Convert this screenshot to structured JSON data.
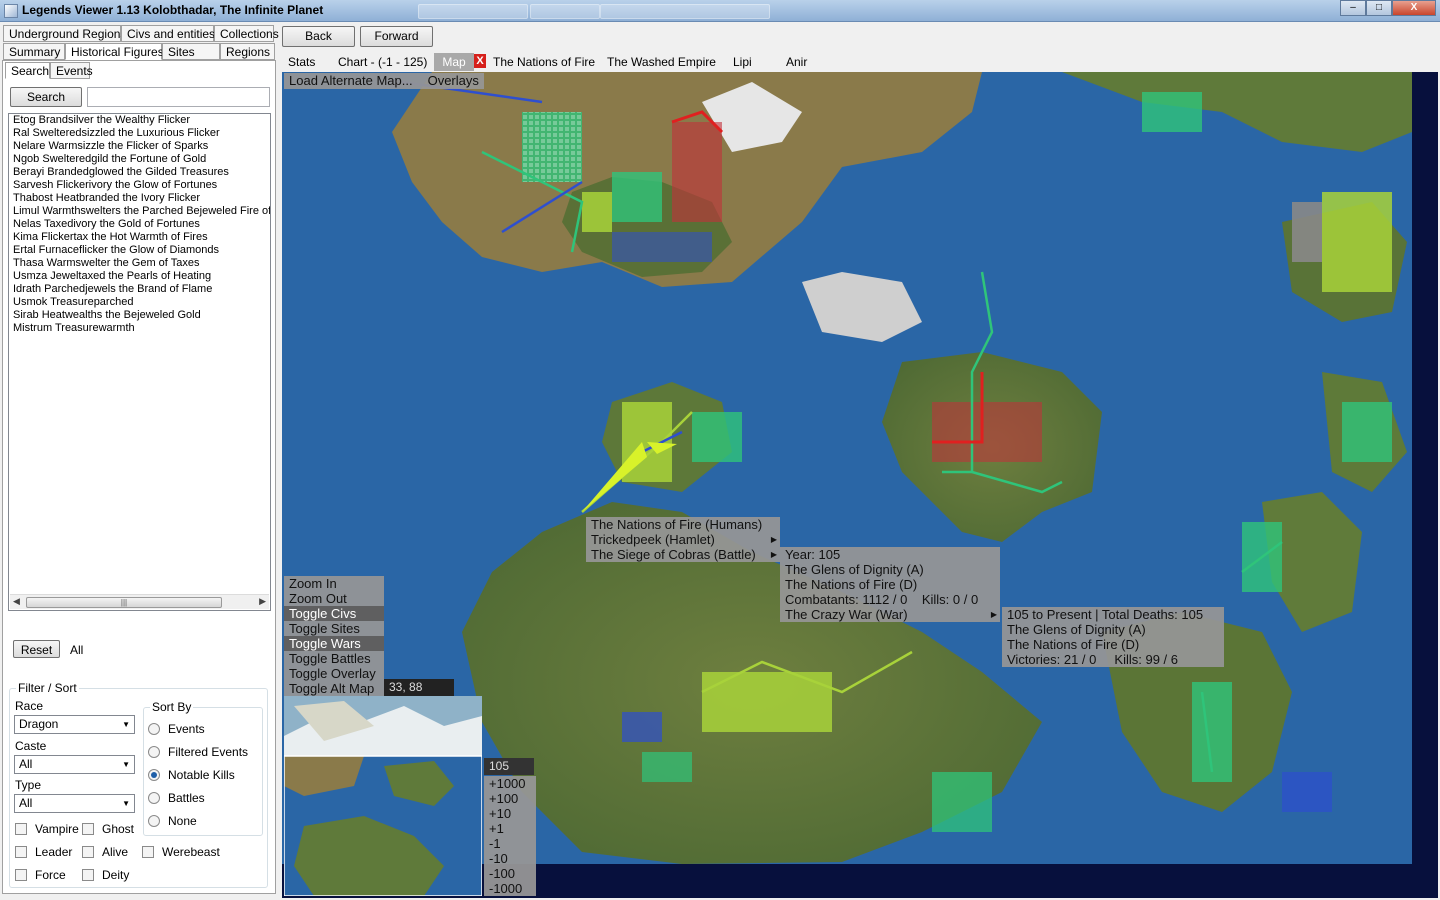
{
  "window": {
    "title": "Legends Viewer 1.13 Kolobthadar, The Infinite Planet",
    "minimize": "–",
    "maximize": "□",
    "close": "X"
  },
  "tabs_row1": [
    "Underground Regions",
    "Civs and entities",
    "Collections"
  ],
  "tabs_row2": [
    "Summary",
    "Historical Figures",
    "Sites",
    "Regions"
  ],
  "subtabs": [
    "Search",
    "Events"
  ],
  "search": {
    "button": "Search",
    "value": ""
  },
  "figures": [
    "Etog Brandsilver the Wealthy Flicker",
    "Ral Swelteredsizzled the Luxurious Flicker",
    "Nelare Warmsizzle the Flicker of Sparks",
    "Ngob Swelteredgild the Fortune of Gold",
    "Berayi Brandedglowed the Gilded Treasures",
    "Sarvesh Flickerivory the Glow of Fortunes",
    "Thabost Heatbranded the Ivory Flicker",
    "Limul Warmthswelters the Parched Bejeweled Fire of B",
    "Nelas Taxedivory the Gold of Fortunes",
    "Kima Flickertax the Hot Warmth of Fires",
    "Ertal Furnaceflicker the Glow of Diamonds",
    "Thasa Warmswelter the Gem of Taxes",
    "Usmza Jeweltaxed the Pearls of Heating",
    "Idrath Parchedjewels the Brand of Flame",
    "Usmok Treasureparched",
    "Sirab Heatwealths the Bejeweled Gold",
    "Mistrum Treasurewarmth"
  ],
  "scroll_grip": "|||",
  "reset": {
    "button": "Reset",
    "label": "All"
  },
  "filter": {
    "group_label": "Filter / Sort",
    "race_label": "Race",
    "race_value": "Dragon",
    "caste_label": "Caste",
    "caste_value": "All",
    "type_label": "Type",
    "type_value": "All",
    "sort_label": "Sort By",
    "sort_options": [
      "Events",
      "Filtered Events",
      "Notable Kills",
      "Battles",
      "None"
    ],
    "sort_selected": "Notable Kills",
    "checks": [
      "Vampire",
      "Ghost",
      "Leader",
      "Alive",
      "Werebeast",
      "Force",
      "Deity"
    ]
  },
  "nav": {
    "back": "Back",
    "forward": "Forward"
  },
  "maptabs": [
    "Stats",
    "Chart - (-1 - 125)",
    "Map",
    "The Nations of Fire",
    "The Washed Empire",
    "Lipi",
    "Anir"
  ],
  "map_close": "X",
  "map_top_menu": [
    "Load Alternate Map...",
    "Overlays"
  ],
  "map_controls": [
    "Zoom In",
    "Zoom Out",
    "Toggle Civs",
    "Toggle Sites",
    "Toggle Wars",
    "Toggle Battles",
    "Toggle Overlay",
    "Toggle Alt Map"
  ],
  "coords": "33, 88",
  "year": "105",
  "year_steps": [
    "+1000",
    "+100",
    "+10",
    "+1",
    "-1",
    "-10",
    "-100",
    "-1000"
  ],
  "popup1": [
    "The Nations of Fire (Humans)",
    "Trickedpeek (Hamlet)",
    "The Siege of Cobras (Battle)"
  ],
  "popup2": [
    "Year: 105",
    "The Glens of Dignity (A)",
    "The Nations of Fire (D)",
    "Combatants: 1112 / 0    Kills: 0 / 0",
    "The Crazy War (War)"
  ],
  "popup3": [
    "105 to Present | Total Deaths: 105",
    "The Glens of Dignity (A)",
    "The Nations of Fire (D)",
    "Victories: 21 / 0     Kills: 99 / 6"
  ],
  "colors": {
    "ocean": "#2a66a6",
    "land": "#5f7a3a",
    "civ_green": "#2fc47a",
    "civ_lime": "#a8d23a",
    "civ_blue": "#2e4fcf",
    "civ_red": "#c2303a"
  }
}
